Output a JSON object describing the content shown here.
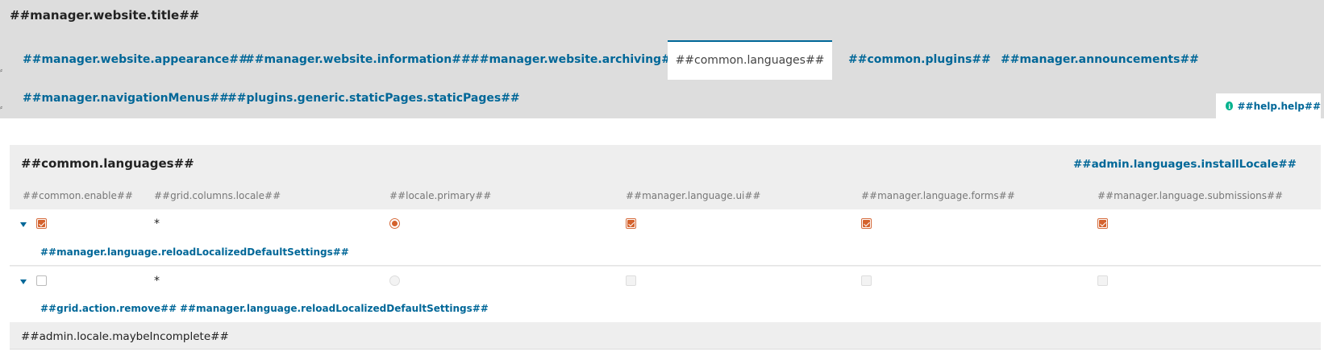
{
  "page": {
    "title": "##manager.website.title##"
  },
  "tabs": [
    {
      "label": "##manager.website.appearance##"
    },
    {
      "label": "##manager.website.information##"
    },
    {
      "label": "##manager.website.archiving##"
    },
    {
      "label": "##common.languages##",
      "active": true
    },
    {
      "label": "##common.plugins##"
    },
    {
      "label": "##manager.announcements##"
    },
    {
      "label": "##manager.navigationMenus##"
    },
    {
      "label": "##plugins.generic.staticPages.staticPages##"
    }
  ],
  "help": {
    "label": "##help.help##",
    "icon": "info-icon"
  },
  "panel": {
    "title": "##common.languages##",
    "install_label": "##admin.languages.installLocale##",
    "columns": [
      "##common.enable##",
      "##grid.columns.locale##",
      "##locale.primary##",
      "##manager.language.ui##",
      "##manager.language.forms##",
      "##manager.language.submissions##"
    ],
    "rows": [
      {
        "locale": "*",
        "enabled": true,
        "primary": true,
        "ui": true,
        "forms": true,
        "submissions": true,
        "actions": [
          "##manager.language.reloadLocalizedDefaultSettings##"
        ]
      },
      {
        "locale": "*",
        "enabled": false,
        "primary": false,
        "ui": false,
        "forms": false,
        "submissions": false,
        "actions": [
          "##grid.action.remove##",
          "##manager.language.reloadLocalizedDefaultSettings##"
        ]
      }
    ],
    "footer_note": "##admin.locale.maybeIncomplete##"
  },
  "colors": {
    "link": "#006798",
    "accent": "#d4622d",
    "header_bg": "#dddddd",
    "panel_bg": "#eeeeee",
    "help_icon": "#00b28d"
  }
}
